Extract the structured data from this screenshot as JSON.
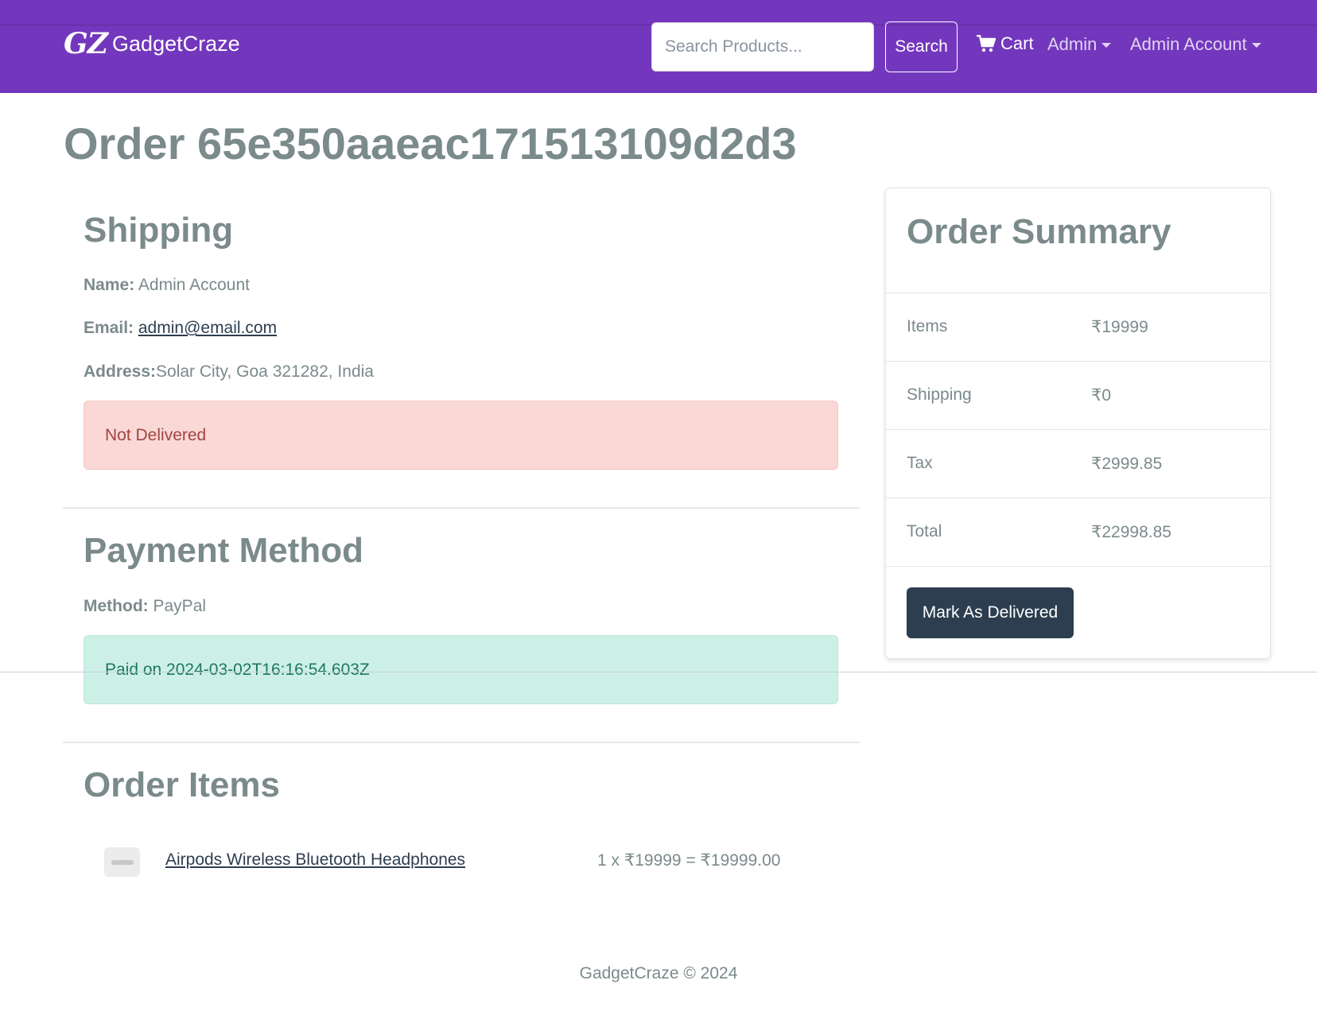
{
  "navbar": {
    "brand_logo": "GZ",
    "brand_name": "GadgetCraze",
    "search_placeholder": "Search Products...",
    "search_label": "Search",
    "cart_label": "Cart",
    "admin_menu": "Admin",
    "account_menu": "Admin Account"
  },
  "order": {
    "title": "Order 65e350aaeac171513109d2d3"
  },
  "shipping": {
    "heading": "Shipping",
    "name_label": "Name:",
    "name_value": "Admin Account",
    "email_label": "Email:",
    "email_value": "admin@email.com",
    "address_label": "Address:",
    "address_value": "Solar City, Goa 321282, India",
    "status": "Not Delivered"
  },
  "payment": {
    "heading": "Payment Method",
    "method_label": "Method:",
    "method_value": "PayPal",
    "status": "Paid on 2024-03-02T16:16:54.603Z"
  },
  "order_items": {
    "heading": "Order Items",
    "items": [
      {
        "name": "Airpods Wireless Bluetooth Headphones",
        "calc": "1 x ₹19999 = ₹19999.00"
      }
    ]
  },
  "summary": {
    "heading": "Order Summary",
    "rows": [
      {
        "label": "Items",
        "value": "₹19999"
      },
      {
        "label": "Shipping",
        "value": "₹0"
      },
      {
        "label": "Tax",
        "value": "₹2999.85"
      },
      {
        "label": "Total",
        "value": "₹22998.85"
      }
    ],
    "button_label": "Mark As Delivered"
  },
  "footer": {
    "text": "GadgetCraze © 2024"
  }
}
